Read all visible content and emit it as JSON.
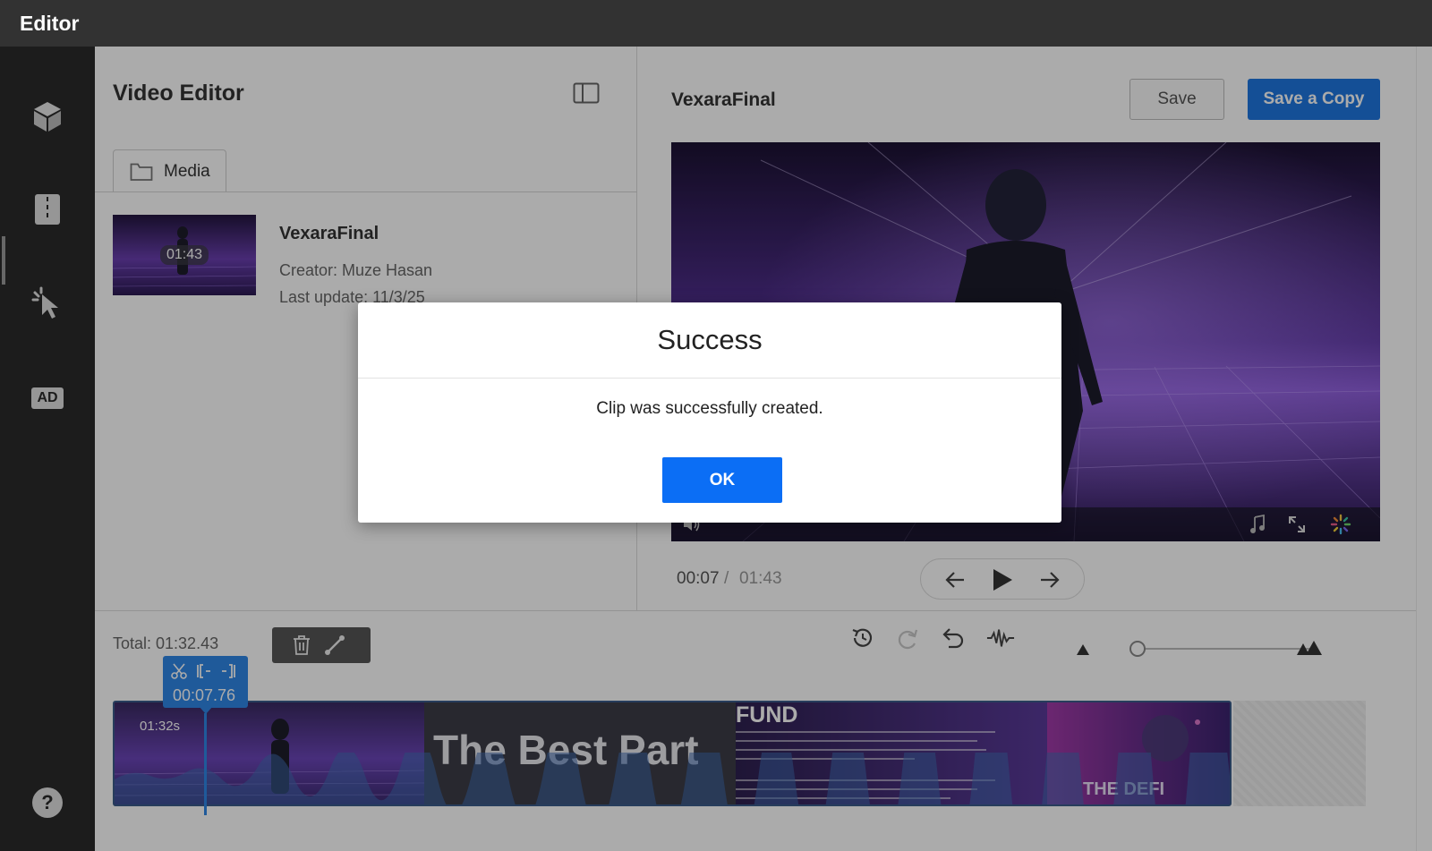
{
  "app": {
    "title": "Editor"
  },
  "sidebar": {
    "items": [
      {
        "icon": "cube-icon"
      },
      {
        "icon": "film-strip-icon",
        "active": true
      },
      {
        "icon": "cursor-click-icon"
      },
      {
        "icon": "ad-icon",
        "label": "AD"
      },
      {
        "icon": "help-icon",
        "label": "?"
      }
    ]
  },
  "left_panel": {
    "title": "Video Editor",
    "tab_label": "Media",
    "media": {
      "thumb_duration": "01:43",
      "name": "VexaraFinal",
      "creator": "Creator: Muze Hasan",
      "last_updated": "Last update: 11/3/25"
    }
  },
  "right_panel": {
    "video_name": "VexaraFinal",
    "save_label": "Save",
    "save_copy_label": "Save a Copy",
    "time_current": "00:07",
    "time_separator": "/",
    "time_total": "01:43"
  },
  "timeline": {
    "total_label": "Total: 01:32.43",
    "track_badge": "01:32s",
    "playhead_time": "00:07.76",
    "segment_title": "The Best Part",
    "segment_fund": "FUND",
    "segment_defi": "THE DEFI",
    "zoom_level": 0.0
  },
  "modal": {
    "title": "Success",
    "message": "Clip was successfully created.",
    "ok_label": "OK"
  },
  "colors": {
    "primary_blue": "#1f76e0",
    "ok_blue": "#0b6ef5",
    "playhead_blue": "#2f86e6",
    "rail": "#2a2a2a",
    "topbar": "#323232"
  }
}
